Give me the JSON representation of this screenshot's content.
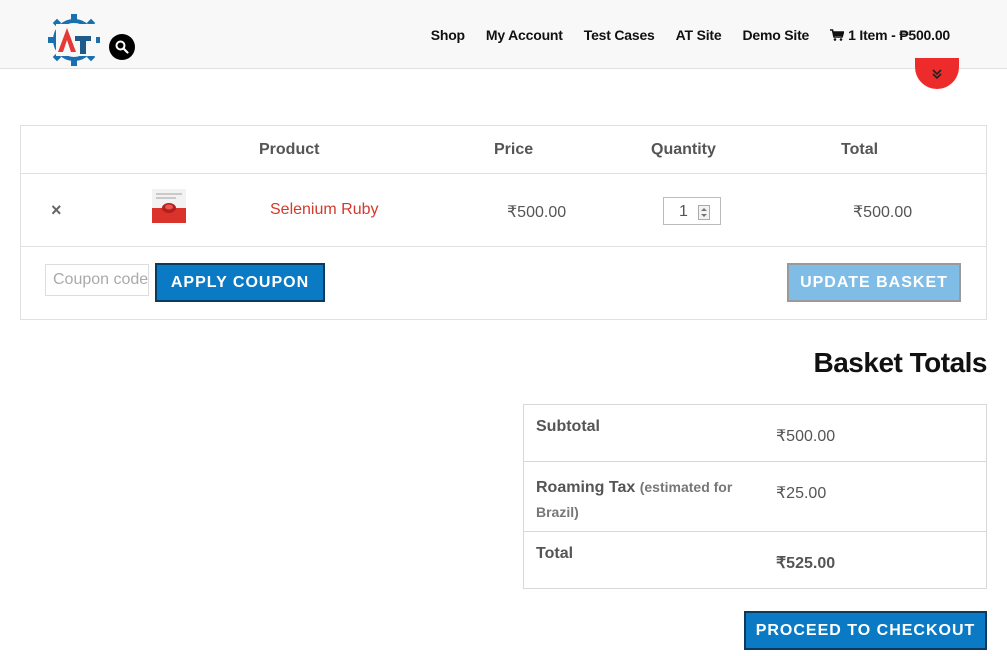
{
  "header": {
    "nav": [
      "Shop",
      "My Account",
      "Test Cases",
      "AT Site",
      "Demo Site"
    ],
    "cart_label": "1 Item - ₱500.00"
  },
  "table": {
    "headers": {
      "product": "Product",
      "price": "Price",
      "quantity": "Quantity",
      "total": "Total"
    },
    "items": [
      {
        "remove": "×",
        "name": "Selenium Ruby",
        "price": "₹500.00",
        "quantity": "1",
        "total": "₹500.00"
      }
    ]
  },
  "coupon": {
    "placeholder": "Coupon code",
    "apply_label": "APPLY COUPON"
  },
  "update_label": "UPDATE BASKET",
  "totals": {
    "title": "Basket Totals",
    "rows": [
      {
        "label": "Subtotal",
        "note": "",
        "value": "₹500.00"
      },
      {
        "label": "Roaming Tax",
        "note": "(estimated for Brazil)",
        "value": "₹25.00"
      },
      {
        "label": "Total",
        "note": "",
        "value": "₹525.00"
      }
    ]
  },
  "checkout_label": "PROCEED TO CHECKOUT",
  "colors": {
    "accent": "#0a7ac4",
    "link": "#d33a2c",
    "scroll_button": "#ee2b2b"
  }
}
